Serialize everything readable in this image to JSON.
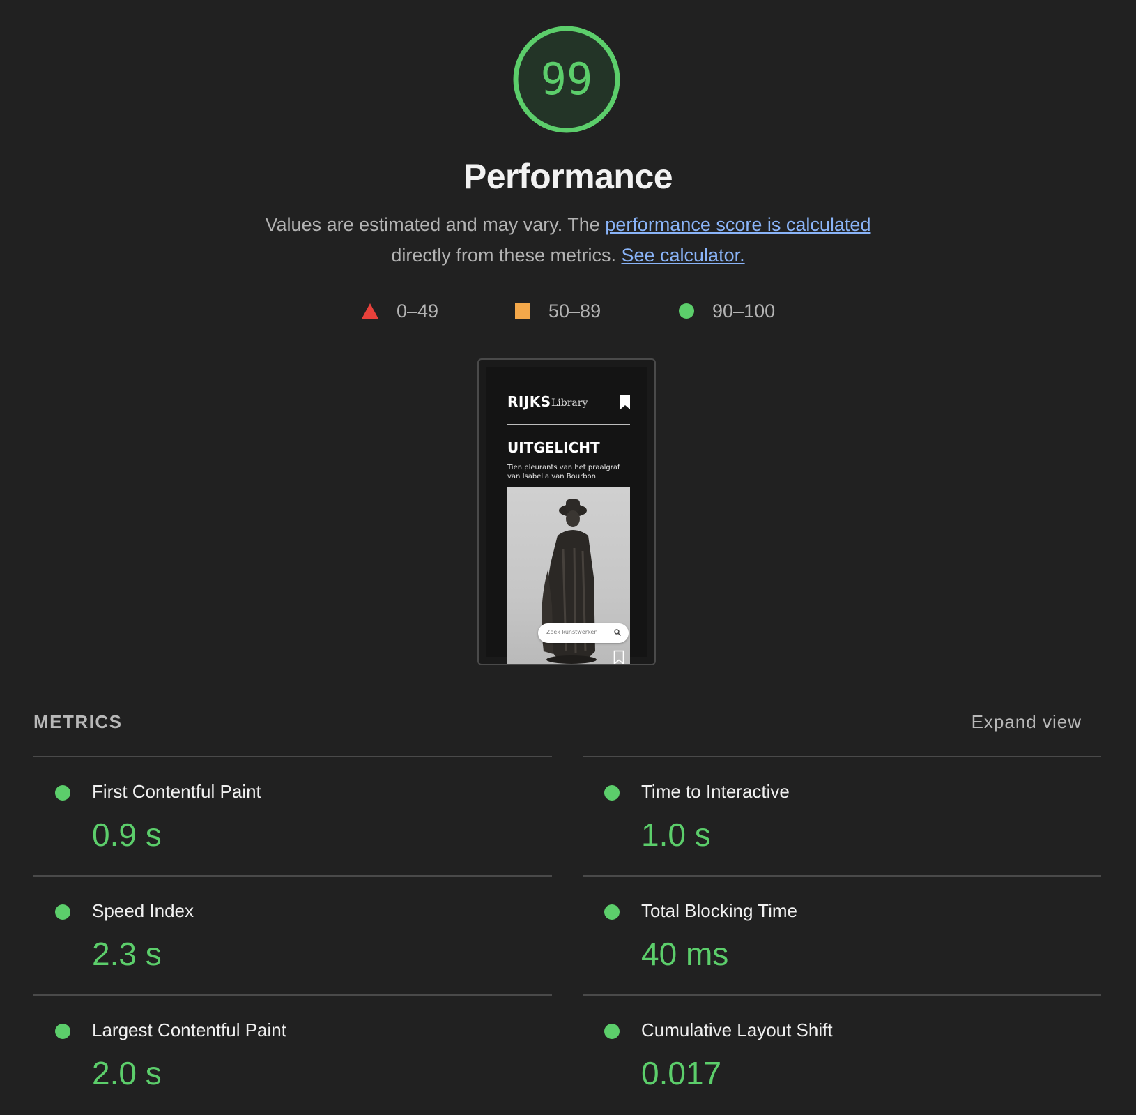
{
  "score": {
    "value": "99",
    "fraction": 0.99,
    "title": "Performance",
    "color": "#5cce6b"
  },
  "description": {
    "text_before": "Values are estimated and may vary. The ",
    "link1": "performance score is calculated",
    "text_middle": " directly from these metrics. ",
    "link2": "See calculator."
  },
  "legend": [
    {
      "icon": "red-triangle-icon",
      "label": "0–49",
      "color": "#e8413b"
    },
    {
      "icon": "orange-square-icon",
      "label": "50–89",
      "color": "#f4a84a"
    },
    {
      "icon": "green-circle-icon",
      "label": "90–100",
      "color": "#5cce6b"
    }
  ],
  "thumbnail": {
    "logo": "RIJKS",
    "logo_sub": "Library",
    "heading": "UITGELICHT",
    "subtitle": "Tien pleurants van het praalgraf van Isabella van Bourbon",
    "search_placeholder": "Zoek kunstwerken"
  },
  "metrics": {
    "header": "METRICS",
    "expand": "Expand view",
    "items": [
      {
        "name": "First Contentful Paint",
        "value": "0.9 s"
      },
      {
        "name": "Time to Interactive",
        "value": "1.0 s"
      },
      {
        "name": "Speed Index",
        "value": "2.3 s"
      },
      {
        "name": "Total Blocking Time",
        "value": "40 ms"
      },
      {
        "name": "Largest Contentful Paint",
        "value": "2.0 s"
      },
      {
        "name": "Cumulative Layout Shift",
        "value": "0.017"
      }
    ]
  }
}
